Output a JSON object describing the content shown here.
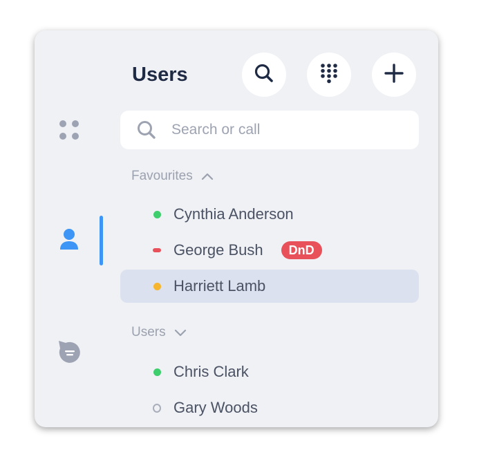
{
  "header": {
    "title": "Users"
  },
  "toolbar": {
    "search_icon": "search-icon",
    "dialpad_icon": "dialpad-icon",
    "add_icon": "plus-icon"
  },
  "rail": {
    "items": [
      {
        "icon": "apps-grid-icon",
        "active": false
      },
      {
        "icon": "user-icon",
        "active": true
      },
      {
        "icon": "chat-bubble-icon",
        "active": false
      }
    ],
    "active_color": "#3d95f5"
  },
  "search": {
    "placeholder": "Search or call",
    "value": ""
  },
  "favourites": {
    "label": "Favourites",
    "expanded": true,
    "contacts": [
      {
        "name": "Cynthia Anderson",
        "status": "online"
      },
      {
        "name": "George Bush",
        "status": "dnd",
        "badge": "DnD"
      },
      {
        "name": "Harriett Lamb",
        "status": "away",
        "selected": true
      }
    ]
  },
  "users": {
    "label": "Users",
    "expanded": false,
    "contacts": [
      {
        "name": "Chris Clark",
        "status": "online"
      },
      {
        "name": "Gary Woods",
        "status": "offline"
      }
    ]
  },
  "colors": {
    "online": "#3fce6d",
    "away": "#f6b52f",
    "dnd": "#e8505a",
    "offline": "#a9aeba",
    "panel_bg": "#eff1f5",
    "selected_row": "#dbe1ee"
  }
}
